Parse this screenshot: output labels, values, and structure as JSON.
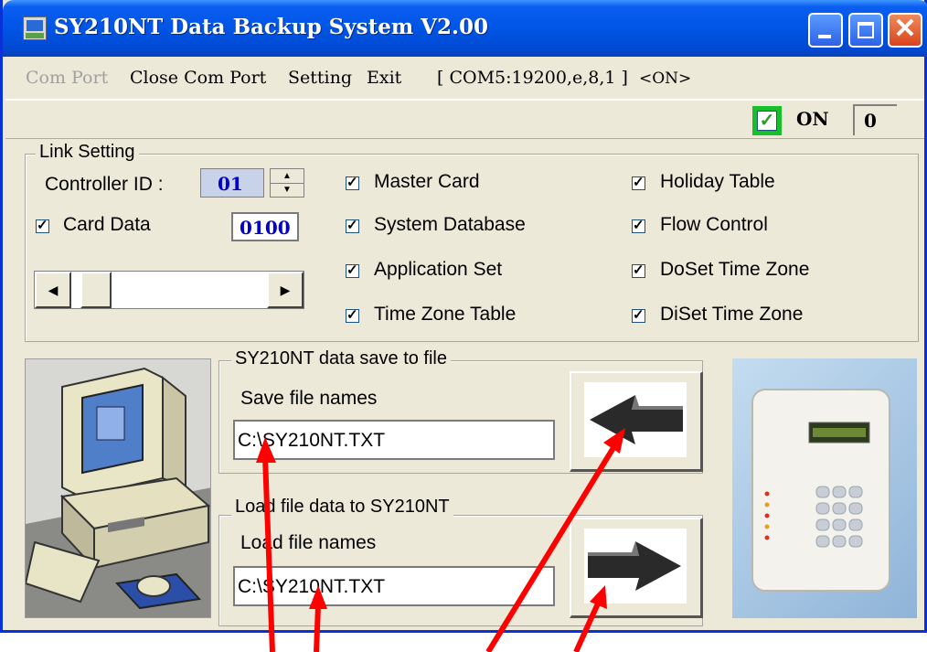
{
  "window": {
    "title": "SY210NT Data Backup System V2.00",
    "minimize_symbol": "_",
    "close_symbol": "✕"
  },
  "menu": {
    "items": [
      "Com Port",
      "Close Com Port",
      "Setting",
      "Exit"
    ],
    "com_info": "[ COM5:19200,e,8,1 ]",
    "status": "<ON>"
  },
  "status": {
    "on_label": "ON",
    "count": "0",
    "checked_mark": "✓"
  },
  "link_setting": {
    "title": "Link Setting",
    "controller_id_label": "Controller ID :",
    "controller_id_value": "01",
    "card_data_label": "Card Data",
    "card_data_value": "0100",
    "spin_up": "▲",
    "spin_down": "▼",
    "scroll_left": "◀",
    "scroll_right": "▶",
    "options_col1": [
      "Master Card",
      "System Database",
      "Application Set",
      "Time Zone Table"
    ],
    "options_col2": [
      "Holiday Table",
      "Flow Control",
      "DoSet Time Zone",
      "DiSet Time Zone"
    ]
  },
  "save_group": {
    "title": "SY210NT data save to file",
    "label": "Save file names",
    "value": "C:\\SY210NT.TXT"
  },
  "load_group": {
    "title": "Load file data to SY210NT",
    "label": "Load file names",
    "value": "C:\\SY210NT.TXT"
  },
  "colors": {
    "titlebar": "#0055e5",
    "window_bg": "#ece9d8",
    "accent_blue": "#0000cc",
    "annotation_red": "#ff0000",
    "status_green": "#17c02a"
  }
}
